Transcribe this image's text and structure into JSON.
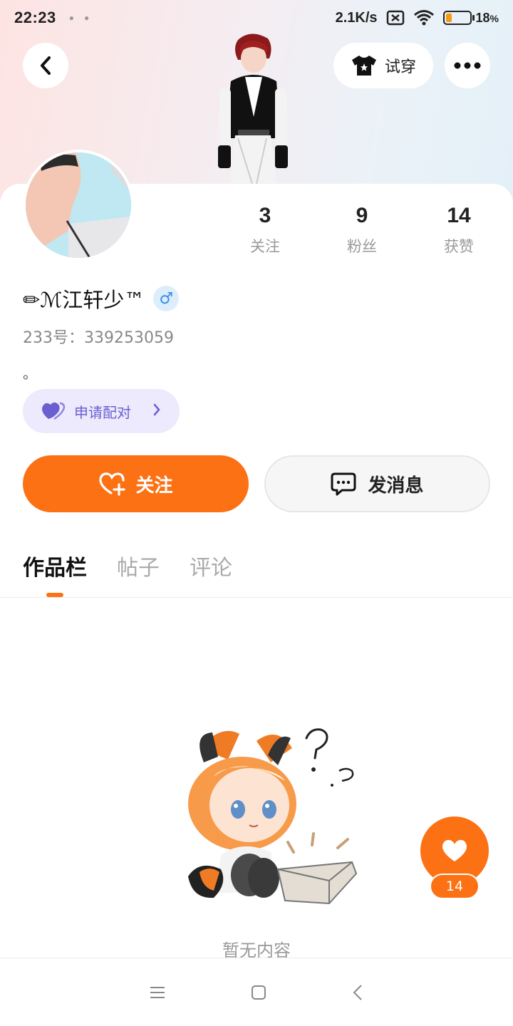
{
  "status_bar": {
    "time": "22:23",
    "network_speed": "2.1K/s",
    "battery_percent": "18",
    "battery_unit": "%",
    "battery_level": 0.18,
    "battery_color": "#f59a16"
  },
  "header": {
    "back_icon": "chevron-left-icon",
    "tryon_label": "试穿",
    "tryon_icon": "tshirt-icon",
    "more_icon": "more-horizontal-icon"
  },
  "profile": {
    "name": "✏ℳ江轩少™",
    "gender_symbol": "♂",
    "uid": "233号：339253059",
    "bio": "。",
    "stats": [
      {
        "value": "3",
        "label": "关注"
      },
      {
        "value": "9",
        "label": "粉丝"
      },
      {
        "value": "14",
        "label": "获赞"
      }
    ]
  },
  "pair_button": {
    "label": "申请配对",
    "icon": "heart-pair-icon",
    "color": "#6b5fd0"
  },
  "actions": {
    "follow_label": "关注",
    "message_label": "发消息",
    "accent": "#fb7114"
  },
  "tabs": [
    {
      "label": "作品栏",
      "active": true
    },
    {
      "label": "帖子",
      "active": false
    },
    {
      "label": "评论",
      "active": false
    }
  ],
  "empty_state": {
    "text": "暂无内容"
  },
  "like_fab": {
    "count": "14",
    "icon": "heart-icon"
  },
  "nav": {
    "menu_icon": "menu-icon",
    "home_icon": "square-icon",
    "back_icon": "back-triangle-icon"
  }
}
